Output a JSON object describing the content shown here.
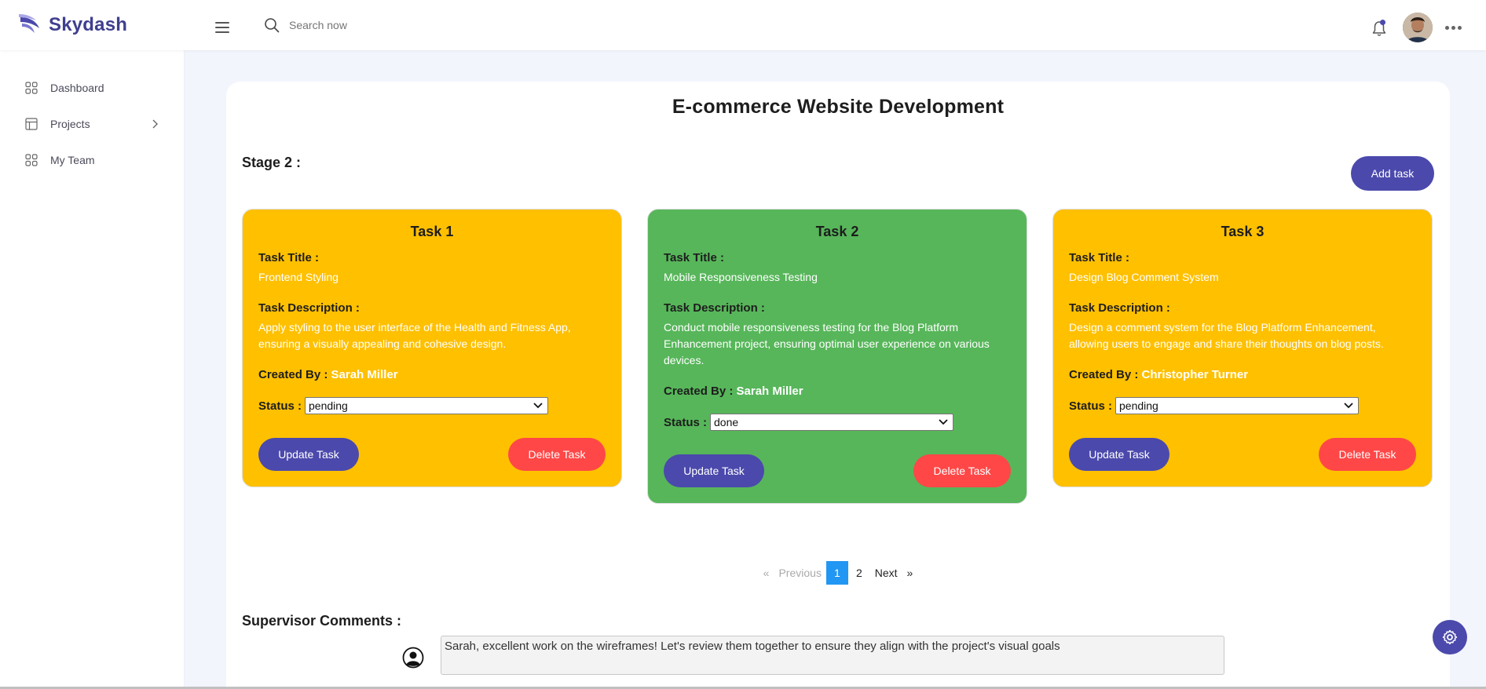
{
  "app": {
    "name": "Skydash"
  },
  "search": {
    "placeholder": "Search now"
  },
  "sidebar": {
    "items": [
      {
        "label": "Dashboard",
        "icon": "grid-icon"
      },
      {
        "label": "Projects",
        "icon": "layout-icon",
        "has_submenu": true
      },
      {
        "label": "My Team",
        "icon": "grid-icon"
      }
    ]
  },
  "project": {
    "title": "E-commerce Website Development",
    "stage_label": "Stage 2 :",
    "add_task_label": "Add task"
  },
  "task_labels": {
    "title": "Task Title :",
    "description": "Task Description :",
    "created_by": "Created By :",
    "status": "Status :",
    "update": "Update Task",
    "delete": "Delete Task"
  },
  "tasks": [
    {
      "heading": "Task 1",
      "title": "Frontend Styling",
      "description": "Apply styling to the user interface of the Health and Fitness App, ensuring a visually appealing and cohesive design.",
      "created_by": "Sarah Miller",
      "status": "pending",
      "color": "#ffc000"
    },
    {
      "heading": "Task 2",
      "title": "Mobile Responsiveness Testing",
      "description": "Conduct mobile responsiveness testing for the Blog Platform Enhancement project, ensuring optimal user experience on various devices.",
      "created_by": "Sarah Miller",
      "status": "done",
      "color": "#57b65a"
    },
    {
      "heading": "Task 3",
      "title": "Design Blog Comment System",
      "description": "Design a comment system for the Blog Platform Enhancement, allowing users to engage and share their thoughts on blog posts.",
      "created_by": "Christopher Turner",
      "status": "pending",
      "color": "#ffc000"
    }
  ],
  "pagination": {
    "first": "«",
    "previous": "Previous",
    "pages": [
      "1",
      "2"
    ],
    "current": "1",
    "next": "Next",
    "last": "»"
  },
  "comments": {
    "heading": "Supervisor Comments :",
    "text": "Sarah, excellent work on the wireframes! Let's review them together to ensure they align with the project's visual goals"
  },
  "colors": {
    "accent": "#4b49ac",
    "danger": "#ff4747",
    "pending": "#ffc000",
    "done": "#57b65a",
    "page_active": "#2196f3"
  }
}
